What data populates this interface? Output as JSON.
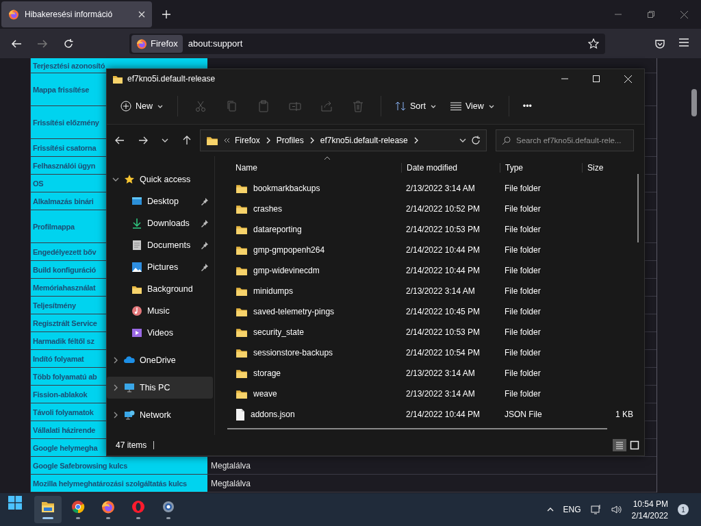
{
  "browser": {
    "tab": {
      "title": "Hibakeresési információ",
      "selected": true
    },
    "identity": "Firefox",
    "url": "about:support"
  },
  "page": {
    "rows": [
      {
        "label": "Terjesztési azonosító"
      },
      {
        "label": "Mappa frissítése"
      },
      {
        "label": "Frissítési előzmény"
      },
      {
        "label": "Frissítési csatorna"
      },
      {
        "label": "Felhasználói ügyn"
      },
      {
        "label": "OS"
      },
      {
        "label": "Alkalmazás binári"
      },
      {
        "label": "Profilmappa"
      },
      {
        "label": "Engedélyezett bőv"
      },
      {
        "label": "Build konfiguráció"
      },
      {
        "label": "Memóriahasználat"
      },
      {
        "label": "Teljesítmény"
      },
      {
        "label": "Regisztrált Service"
      },
      {
        "label": "Harmadik féltől sz"
      },
      {
        "label": "Indító folyamat"
      },
      {
        "label": "Több folyamatú ab"
      },
      {
        "label": "Fission-ablakok"
      },
      {
        "label": "Távoli folyamatok"
      },
      {
        "label": "Vállalati házirende"
      },
      {
        "label": "Google helymegha"
      },
      {
        "label": "Google Safebrowsing kulcs",
        "value": "Megtalálva"
      },
      {
        "label": "Mozilla helymeghatározási szolgáltatás kulcs",
        "value": "Megtalálva"
      }
    ]
  },
  "explorer": {
    "title": "ef7kno5i.default-release",
    "toolbar": {
      "new": "New",
      "actions": [
        {
          "disabled": true
        },
        {
          "disabled": true
        },
        {
          "disabled": true
        },
        {
          "disabled": true
        },
        {
          "disabled": true
        },
        {
          "disabled": true
        }
      ],
      "sort": "Sort",
      "view": "View",
      "more": "•••"
    },
    "breadcrumb": [
      "Firefox",
      "Profiles",
      "ef7kno5i.default-release"
    ],
    "search": {
      "placeholder": "Search ef7kno5i.default-rele..."
    },
    "nav": [
      {
        "label": "Quick access",
        "expanded": true,
        "selected": false,
        "children": [
          {
            "label": "Desktop",
            "pinned": true,
            "selected": false
          },
          {
            "label": "Downloads",
            "pinned": true,
            "selected": false
          },
          {
            "label": "Documents",
            "pinned": true,
            "selected": false
          },
          {
            "label": "Pictures",
            "pinned": true,
            "selected": false
          },
          {
            "label": "Background",
            "pinned": false,
            "selected": false
          },
          {
            "label": "Music",
            "pinned": false,
            "selected": false
          },
          {
            "label": "Videos",
            "pinned": false,
            "selected": false
          }
        ]
      },
      {
        "label": "OneDrive",
        "expanded": false,
        "selected": false
      },
      {
        "label": "This PC",
        "expanded": false,
        "selected": true
      },
      {
        "label": "Network",
        "expanded": false,
        "selected": false
      }
    ],
    "columns": [
      "Name",
      "Date modified",
      "Type",
      "Size"
    ],
    "files": [
      {
        "kind": "folder",
        "name": "bookmarkbackups",
        "date": "2/13/2022 3:14 AM",
        "type": "File folder"
      },
      {
        "kind": "folder",
        "name": "crashes",
        "date": "2/14/2022 10:52 PM",
        "type": "File folder"
      },
      {
        "kind": "folder",
        "name": "datareporting",
        "date": "2/14/2022 10:53 PM",
        "type": "File folder"
      },
      {
        "kind": "folder",
        "name": "gmp-gmpopenh264",
        "date": "2/14/2022 10:44 PM",
        "type": "File folder"
      },
      {
        "kind": "folder",
        "name": "gmp-widevinecdm",
        "date": "2/14/2022 10:44 PM",
        "type": "File folder"
      },
      {
        "kind": "folder",
        "name": "minidumps",
        "date": "2/13/2022 3:14 AM",
        "type": "File folder"
      },
      {
        "kind": "folder",
        "name": "saved-telemetry-pings",
        "date": "2/14/2022 10:45 PM",
        "type": "File folder"
      },
      {
        "kind": "folder",
        "name": "security_state",
        "date": "2/14/2022 10:53 PM",
        "type": "File folder"
      },
      {
        "kind": "folder",
        "name": "sessionstore-backups",
        "date": "2/14/2022 10:54 PM",
        "type": "File folder"
      },
      {
        "kind": "folder",
        "name": "storage",
        "date": "2/13/2022 3:14 AM",
        "type": "File folder"
      },
      {
        "kind": "folder",
        "name": "weave",
        "date": "2/13/2022 3:14 AM",
        "type": "File folder"
      },
      {
        "kind": "file",
        "name": "addons.json",
        "date": "2/14/2022 10:44 PM",
        "type": "JSON File",
        "size": "1 KB"
      }
    ],
    "status": "47 items",
    "views": [
      {
        "selected": true
      },
      {
        "selected": false
      }
    ]
  },
  "taskbar": {
    "apps": [
      {
        "active": true
      },
      {
        "active": false
      },
      {
        "active": false
      },
      {
        "active": false
      },
      {
        "active": false
      }
    ],
    "language": "ENG",
    "time": "10:54 PM",
    "date": "2/14/2022",
    "notifications": "1"
  }
}
